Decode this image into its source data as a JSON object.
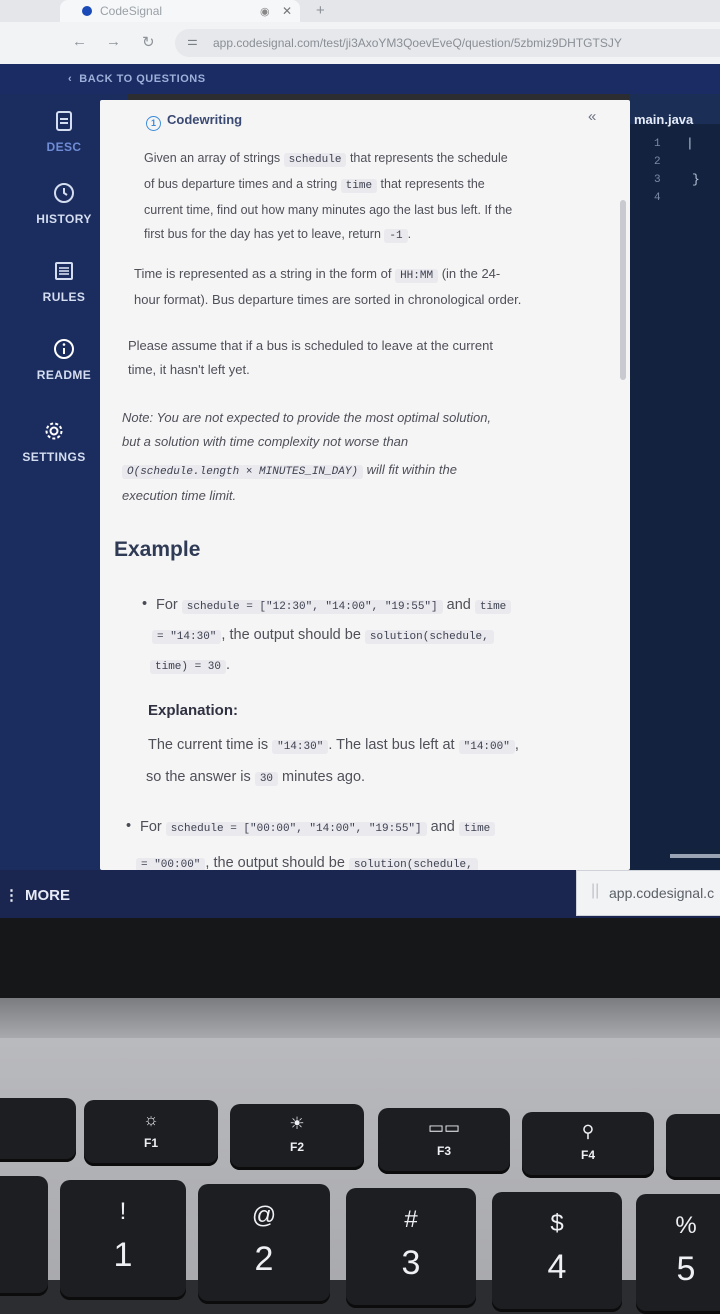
{
  "browser": {
    "tab_title": "CodeSignal",
    "url": "app.codesignal.com/test/ji3AxoYM3QoevEveQ/question/5zbmiz9DHTGTSJY"
  },
  "app": {
    "back_label": "BACK TO QUESTIONS",
    "sidebar": [
      {
        "label": "DESC",
        "icon": "document-icon"
      },
      {
        "label": "HISTORY",
        "icon": "clock-icon"
      },
      {
        "label": "RULES",
        "icon": "list-icon"
      },
      {
        "label": "README",
        "icon": "info-icon"
      },
      {
        "label": "SETTINGS",
        "icon": "gear-icon"
      }
    ],
    "more_label": "MORE",
    "status_url": "app.codesignal.c"
  },
  "problem": {
    "header": "Codewriting",
    "p1": {
      "a": "Given an array of strings ",
      "code1": "schedule",
      "b": " that represents the schedule",
      "c": "of bus departure times and a string ",
      "code2": "time",
      "d": " that represents the",
      "e": "current time, find out how many minutes ago the last bus left. If the",
      "f": "first bus for the day has yet to leave, return ",
      "code3": "-1",
      "g": "."
    },
    "p2": {
      "a": "Time is represented as a string in the form of ",
      "code": "HH:MM",
      "b": " (in the 24-",
      "c": "hour format). Bus departure times are sorted in chronological order."
    },
    "p3": {
      "a": "Please assume that if a bus is scheduled to leave at the current",
      "b": "time, it hasn't left yet."
    },
    "p4": {
      "a": "Note: You are not expected to provide the most optimal solution,",
      "b": "but a solution with time complexity not worse than",
      "code": "O(schedule.length × MINUTES_IN_DAY)",
      "c": " will fit within the",
      "d": "execution time limit."
    },
    "example_title": "Example",
    "ex1": {
      "for": "For ",
      "code1": "schedule = [\"12:30\", \"14:00\", \"19:55\"]",
      "and": " and ",
      "code2": "time",
      "code3": "= \"14:30\"",
      "mid": ", the output should be ",
      "code4": "solution(schedule,",
      "code5": "time) = 30",
      "end": "."
    },
    "explanation_title": "Explanation:",
    "exp1": {
      "a": "The current time is ",
      "code1": "\"14:30\"",
      "b": ". The last bus left at ",
      "code2": "\"14:00\"",
      "c": ",",
      "d": "so the answer is ",
      "code3": "30",
      "e": " minutes ago."
    },
    "ex2": {
      "for": "For ",
      "code1": "schedule = [\"00:00\", \"14:00\", \"19:55\"]",
      "and": " and ",
      "code2": "time",
      "code3": "= \"00:00\"",
      "mid": ", the output should be ",
      "code4": "solution(schedule,"
    }
  },
  "editor": {
    "filename": "main.java",
    "line_numbers": [
      "1",
      "2",
      "3",
      "4"
    ]
  },
  "keyboard": {
    "fkeys": [
      {
        "label": "F1",
        "icon": "brightness-down-icon"
      },
      {
        "label": "F2",
        "icon": "brightness-up-icon"
      },
      {
        "label": "F3",
        "icon": "mission-control-icon"
      },
      {
        "label": "F4",
        "icon": "search-icon"
      }
    ],
    "numkeys": [
      {
        "top": "!",
        "bottom": "1"
      },
      {
        "top": "@",
        "bottom": "2"
      },
      {
        "top": "#",
        "bottom": "3"
      },
      {
        "top": "$",
        "bottom": "4"
      },
      {
        "top": "%",
        "bottom": "5"
      }
    ]
  }
}
